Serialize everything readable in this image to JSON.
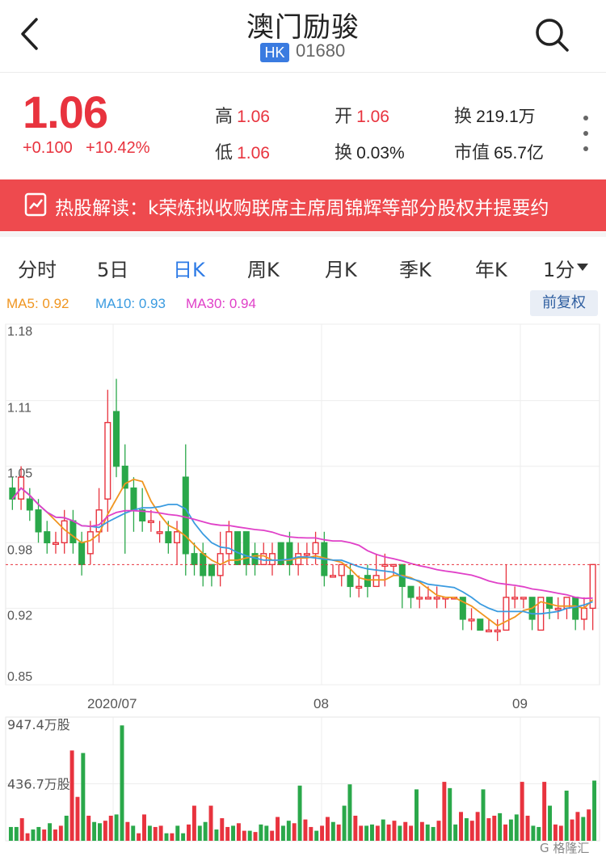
{
  "header": {
    "back_icon": "chevron-left-icon",
    "title": "澳门励骏",
    "market_badge": "HK",
    "code": "01680",
    "search_icon": "search-icon"
  },
  "quote": {
    "price": "1.06",
    "change": "+0.100",
    "change_pct": "+10.42%",
    "high_label": "高",
    "high": "1.06",
    "open_label": "开",
    "open": "1.06",
    "turnover_label": "换",
    "turnover_amount": "219.1万",
    "low_label": "低",
    "low": "1.06",
    "turnover_rate_label": "换",
    "turnover_rate": "0.03%",
    "mktcap_label": "市值",
    "mktcap": "65.7亿",
    "up_color": "#e8333e"
  },
  "banner": {
    "text": "热股解读：k荣炼拟收购联席主席周锦辉等部分股权并提要约",
    "icon": "chart-line-icon",
    "color": "#ee4a4e"
  },
  "tabs": [
    "分时",
    "5日",
    "日K",
    "周K",
    "月K",
    "季K",
    "年K",
    "1分"
  ],
  "active_tab": "日K",
  "ma": {
    "ma5": "MA5: 0.92",
    "ma10": "MA10: 0.93",
    "ma30": "MA30: 0.94",
    "ma5_color": "#f0951f",
    "ma10_color": "#3a9be0",
    "ma30_color": "#e040c8"
  },
  "adjust_button": "前复权",
  "chart_data": {
    "type": "candlestick",
    "y_ticks": [
      "1.18",
      "1.11",
      "1.05",
      "0.98",
      "0.92",
      "0.85"
    ],
    "ylim": [
      0.85,
      1.18
    ],
    "x_ticks": [
      "2020/07",
      "08",
      "09"
    ],
    "volume_ticks": [
      "947.4万股",
      "436.7万股"
    ],
    "up_color": "#e8333e",
    "down_color": "#2aa84a",
    "candles": [
      [
        1.03,
        1.02,
        1.04,
        1.01
      ],
      [
        1.02,
        1.04,
        1.05,
        1.01
      ],
      [
        1.02,
        1.01,
        1.03,
        1.0
      ],
      [
        1.01,
        0.99,
        1.02,
        0.98
      ],
      [
        0.99,
        0.98,
        1.0,
        0.97
      ],
      [
        0.98,
        0.98,
        0.99,
        0.97
      ],
      [
        0.98,
        1.0,
        1.01,
        0.97
      ],
      [
        1.0,
        0.98,
        1.01,
        0.97
      ],
      [
        0.98,
        0.96,
        0.99,
        0.95
      ],
      [
        0.97,
        0.99,
        1.0,
        0.96
      ],
      [
        0.99,
        1.01,
        1.03,
        0.98
      ],
      [
        1.02,
        1.09,
        1.12,
        0.99
      ],
      [
        1.1,
        1.05,
        1.13,
        1.04
      ],
      [
        1.05,
        1.03,
        1.07,
        0.97
      ],
      [
        1.03,
        1.01,
        1.04,
        0.99
      ],
      [
        1.01,
        1.0,
        1.03,
        0.99
      ],
      [
        1.0,
        1.0,
        1.01,
        0.99
      ],
      [
        0.99,
        0.99,
        1.0,
        0.98
      ],
      [
        0.99,
        0.98,
        1.0,
        0.97
      ],
      [
        0.98,
        0.99,
        1.0,
        0.96
      ],
      [
        1.04,
        0.97,
        1.07,
        0.95
      ],
      [
        0.97,
        0.96,
        0.98,
        0.95
      ],
      [
        0.97,
        0.95,
        0.98,
        0.94
      ],
      [
        0.96,
        0.95,
        0.96,
        0.94
      ],
      [
        0.95,
        0.97,
        0.99,
        0.94
      ],
      [
        0.97,
        0.99,
        1.0,
        0.96
      ],
      [
        0.99,
        0.96,
        0.99,
        0.96
      ],
      [
        0.99,
        0.96,
        0.99,
        0.95
      ],
      [
        0.97,
        0.96,
        0.98,
        0.95
      ],
      [
        0.96,
        0.97,
        0.98,
        0.96
      ],
      [
        0.96,
        0.97,
        0.98,
        0.95
      ],
      [
        0.98,
        0.96,
        0.98,
        0.96
      ],
      [
        0.98,
        0.96,
        0.99,
        0.95
      ],
      [
        0.96,
        0.97,
        0.98,
        0.95
      ],
      [
        0.97,
        0.97,
        0.98,
        0.96
      ],
      [
        0.97,
        0.98,
        0.99,
        0.96
      ],
      [
        0.98,
        0.95,
        0.99,
        0.94
      ],
      [
        0.95,
        0.95,
        0.96,
        0.95
      ],
      [
        0.95,
        0.96,
        0.96,
        0.94
      ],
      [
        0.95,
        0.94,
        0.96,
        0.93
      ],
      [
        0.94,
        0.94,
        0.95,
        0.93
      ],
      [
        0.95,
        0.94,
        0.96,
        0.93
      ],
      [
        0.94,
        0.95,
        0.97,
        0.94
      ],
      [
        0.96,
        0.96,
        0.97,
        0.94
      ],
      [
        0.96,
        0.96,
        0.96,
        0.95
      ],
      [
        0.96,
        0.94,
        0.96,
        0.92
      ],
      [
        0.94,
        0.93,
        0.94,
        0.92
      ],
      [
        0.93,
        0.93,
        0.94,
        0.92
      ],
      [
        0.93,
        0.93,
        0.94,
        0.93
      ],
      [
        0.93,
        0.93,
        0.94,
        0.92
      ],
      [
        0.93,
        0.93,
        0.93,
        0.92
      ],
      [
        0.93,
        0.93,
        0.93,
        0.93
      ],
      [
        0.93,
        0.91,
        0.93,
        0.9
      ],
      [
        0.91,
        0.91,
        0.92,
        0.9
      ],
      [
        0.91,
        0.9,
        0.91,
        0.9
      ],
      [
        0.9,
        0.9,
        0.91,
        0.9
      ],
      [
        0.9,
        0.9,
        0.91,
        0.89
      ],
      [
        0.9,
        0.93,
        0.96,
        0.9
      ],
      [
        0.93,
        0.93,
        0.94,
        0.92
      ],
      [
        0.93,
        0.93,
        0.93,
        0.92
      ],
      [
        0.93,
        0.91,
        0.93,
        0.9
      ],
      [
        0.9,
        0.93,
        0.93,
        0.9
      ],
      [
        0.93,
        0.92,
        0.93,
        0.91
      ],
      [
        0.92,
        0.92,
        0.93,
        0.91
      ],
      [
        0.92,
        0.93,
        0.93,
        0.91
      ],
      [
        0.93,
        0.91,
        0.93,
        0.9
      ],
      [
        0.91,
        0.92,
        0.93,
        0.9
      ],
      [
        0.92,
        0.96,
        0.96,
        0.9
      ]
    ],
    "volume": [
      110,
      110,
      180,
      60,
      90,
      110,
      90,
      140,
      90,
      120,
      200,
      720,
      350,
      700,
      200,
      150,
      140,
      160,
      200,
      210,
      920,
      150,
      120,
      60,
      210,
      120,
      110,
      120,
      60,
      60,
      120,
      60,
      130,
      280,
      120,
      150,
      280,
      90,
      180,
      110,
      120,
      140,
      80,
      80,
      70,
      130,
      120,
      80,
      190,
      120,
      160,
      140,
      440,
      170,
      110,
      80,
      120,
      190,
      150,
      130,
      280,
      450,
      200,
      120,
      120,
      130,
      120,
      170,
      130,
      160,
      120,
      150,
      120,
      410,
      150,
      130,
      110,
      160,
      470,
      420,
      130,
      230,
      180,
      160,
      230,
      410,
      180,
      200,
      220,
      130,
      170,
      210,
      470,
      200,
      120,
      110,
      470,
      280,
      130,
      120,
      400,
      170,
      230,
      190,
      250,
      480
    ]
  },
  "watermark": "G 格隆汇"
}
